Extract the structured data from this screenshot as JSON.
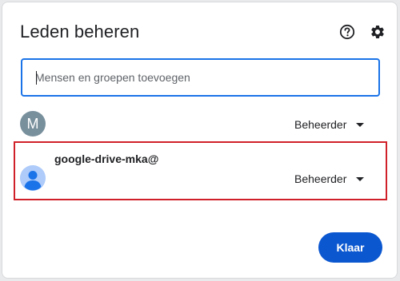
{
  "dialog": {
    "title": "Leden beheren",
    "help_icon": "help-icon",
    "settings_icon": "gear-icon"
  },
  "search": {
    "placeholder": "Mensen en groepen toevoegen",
    "value": ""
  },
  "members": [
    {
      "avatar_letter": "M",
      "avatar_color": "#78909c",
      "name": "",
      "role": "Beheerder"
    },
    {
      "avatar_icon": "person-icon",
      "avatar_color": "#8ab4f8",
      "name": "google-drive-mka@",
      "role": "Beheerder",
      "highlight_color": "#d0212a"
    }
  ],
  "footer": {
    "done_label": "Klaar",
    "done_color": "#0b57d0"
  }
}
